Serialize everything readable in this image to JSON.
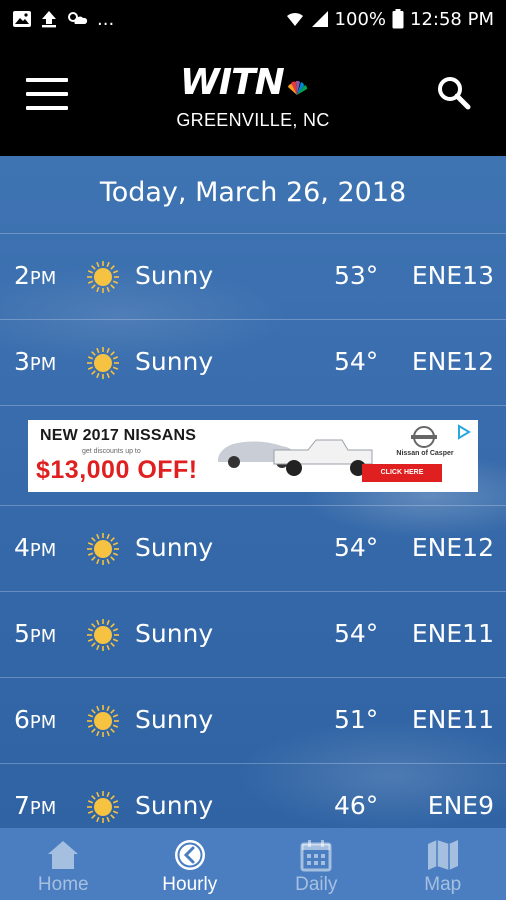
{
  "status_bar": {
    "battery": "100%",
    "time": "12:58 PM",
    "dots": "..."
  },
  "header": {
    "logo": "WITN",
    "location": "GREENVILLE, NC"
  },
  "date_title": "Today, March 26, 2018",
  "hours": [
    {
      "hour": "2",
      "ampm": "PM",
      "condition": "Sunny",
      "temp": "53°",
      "wind": "ENE13"
    },
    {
      "hour": "3",
      "ampm": "PM",
      "condition": "Sunny",
      "temp": "54°",
      "wind": "ENE12"
    },
    {
      "hour": "4",
      "ampm": "PM",
      "condition": "Sunny",
      "temp": "54°",
      "wind": "ENE12"
    },
    {
      "hour": "5",
      "ampm": "PM",
      "condition": "Sunny",
      "temp": "54°",
      "wind": "ENE11"
    },
    {
      "hour": "6",
      "ampm": "PM",
      "condition": "Sunny",
      "temp": "51°",
      "wind": "ENE11"
    },
    {
      "hour": "7",
      "ampm": "PM",
      "condition": "Sunny",
      "temp": "46°",
      "wind": "ENE9"
    }
  ],
  "ad": {
    "headline": "NEW 2017 NISSANS",
    "sub": "get discounts up to",
    "offer": "$13,000 OFF!",
    "dealer": "Nissan of Casper",
    "cta": "CLICK HERE"
  },
  "tabs": [
    {
      "label": "Home",
      "icon": "home-icon"
    },
    {
      "label": "Hourly",
      "icon": "clock-icon"
    },
    {
      "label": "Daily",
      "icon": "calendar-icon"
    },
    {
      "label": "Map",
      "icon": "map-icon"
    }
  ],
  "colors": {
    "header_bg": "#000000",
    "sky": "#3a6eae",
    "tab_bar": "#4a7ec1",
    "sun": "#f5c242",
    "ad_red": "#e02020"
  }
}
